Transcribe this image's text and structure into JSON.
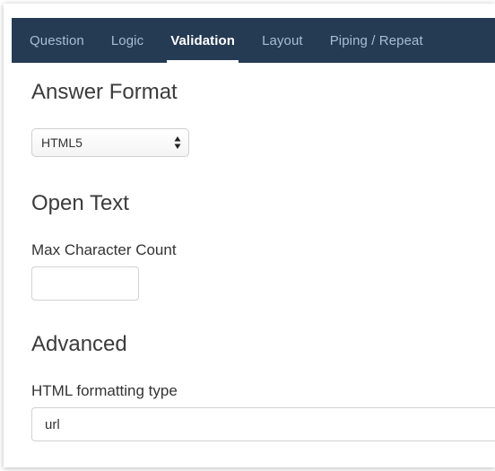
{
  "tabs": [
    {
      "label": "Question",
      "active": false
    },
    {
      "label": "Logic",
      "active": false
    },
    {
      "label": "Validation",
      "active": true
    },
    {
      "label": "Layout",
      "active": false
    },
    {
      "label": "Piping / Repeat",
      "active": false
    }
  ],
  "answer_format": {
    "title": "Answer Format",
    "selected": "HTML5"
  },
  "open_text": {
    "title": "Open Text",
    "max_char_label": "Max Character Count",
    "max_char_value": ""
  },
  "advanced": {
    "title": "Advanced",
    "html_type_label": "HTML formatting type",
    "html_type_value": "url"
  },
  "colors": {
    "tabbar_bg": "#253a53",
    "tab_inactive": "#a9bdd4",
    "tab_active": "#ffffff"
  },
  "icons": {
    "select_arrows": "updown-arrows-icon"
  }
}
